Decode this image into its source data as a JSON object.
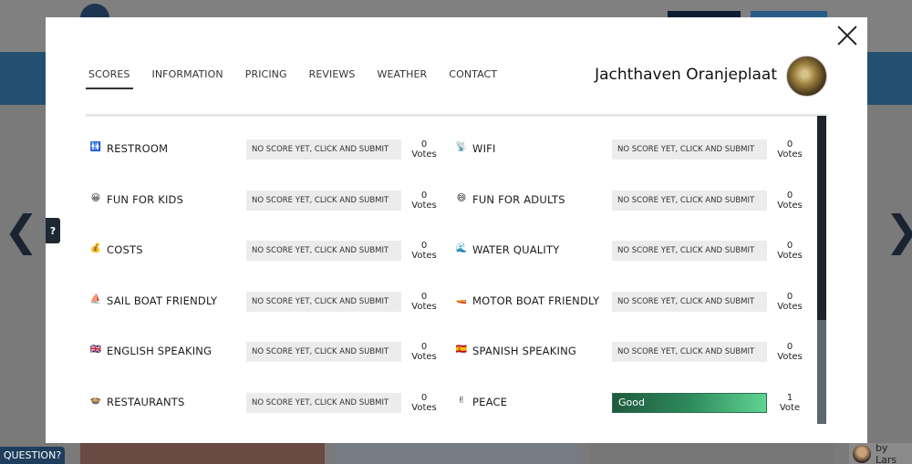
{
  "background": {
    "question_label": "QUESTION?",
    "help_tab_label": "?",
    "credit_label": "by Lars",
    "nav_prev": "❮",
    "nav_next": "❯"
  },
  "modal": {
    "title": "Jachthaven Oranjeplaat",
    "tabs": [
      {
        "label": "SCORES",
        "active": true
      },
      {
        "label": "INFORMATION",
        "active": false
      },
      {
        "label": "PRICING",
        "active": false
      },
      {
        "label": "REVIEWS",
        "active": false
      },
      {
        "label": "WEATHER",
        "active": false
      },
      {
        "label": "CONTACT",
        "active": false
      }
    ],
    "scores": [
      [
        {
          "icon": "restroom-icon",
          "glyph": "🚻",
          "label": "RESTROOM",
          "value": "NO SCORE YET, CLICK AND SUBMIT",
          "count": "0",
          "unit": "Votes"
        },
        {
          "icon": "wifi-icon",
          "glyph": "📡",
          "label": "WIFI",
          "value": "NO SCORE YET, CLICK AND SUBMIT",
          "count": "0",
          "unit": "Votes"
        }
      ],
      [
        {
          "icon": "smile-icon",
          "glyph": "😀",
          "label": "FUN FOR KIDS",
          "value": "NO SCORE YET, CLICK AND SUBMIT",
          "count": "0",
          "unit": "Votes"
        },
        {
          "icon": "grin-icon",
          "glyph": "😄",
          "label": "FUN FOR ADULTS",
          "value": "NO SCORE YET, CLICK AND SUBMIT",
          "count": "0",
          "unit": "Votes"
        }
      ],
      [
        {
          "icon": "money-bag-icon",
          "glyph": "💰",
          "label": "COSTS",
          "value": "NO SCORE YET, CLICK AND SUBMIT",
          "count": "0",
          "unit": "Votes"
        },
        {
          "icon": "wave-icon",
          "glyph": "🌊",
          "label": "WATER QUALITY",
          "value": "NO SCORE YET, CLICK AND SUBMIT",
          "count": "0",
          "unit": "Votes"
        }
      ],
      [
        {
          "icon": "sailboat-icon",
          "glyph": "⛵",
          "label": "SAIL BOAT FRIENDLY",
          "value": "NO SCORE YET, CLICK AND SUBMIT",
          "count": "0",
          "unit": "Votes"
        },
        {
          "icon": "motorboat-icon",
          "glyph": "🚤",
          "label": "MOTOR BOAT FRIENDLY",
          "value": "NO SCORE YET, CLICK AND SUBMIT",
          "count": "0",
          "unit": "Votes"
        }
      ],
      [
        {
          "icon": "english-flag-icon",
          "glyph": "🇬🇧",
          "label": "ENGLISH SPEAKING",
          "value": "NO SCORE YET, CLICK AND SUBMIT",
          "count": "0",
          "unit": "Votes"
        },
        {
          "icon": "spanish-flag-icon",
          "glyph": "🇪🇸",
          "label": "SPANISH SPEAKING",
          "value": "NO SCORE YET, CLICK AND SUBMIT",
          "count": "0",
          "unit": "Votes"
        }
      ],
      [
        {
          "icon": "restaurant-icon",
          "glyph": "🍲",
          "label": "RESTAURANTS",
          "value": "NO SCORE YET, CLICK AND SUBMIT",
          "count": "0",
          "unit": "Votes"
        },
        {
          "icon": "peace-hand-icon",
          "glyph": "✌",
          "label": "PEACE",
          "value": "Good",
          "count": "1",
          "unit": "Vote",
          "rated": true
        }
      ]
    ]
  }
}
